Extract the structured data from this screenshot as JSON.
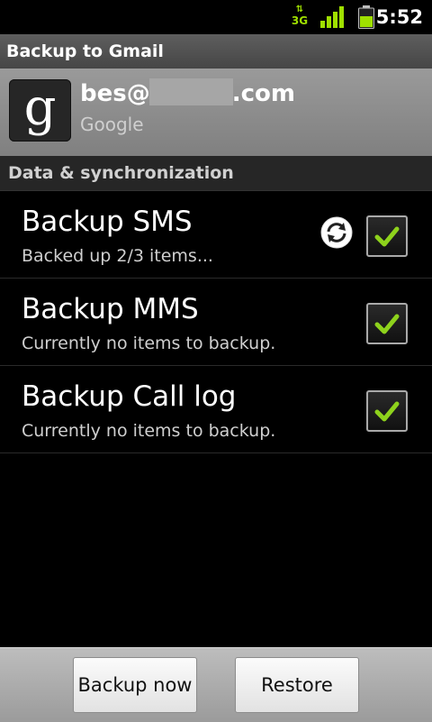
{
  "status": {
    "network_type": "3G",
    "time": "5:52"
  },
  "titlebar": {
    "title": "Backup to Gmail"
  },
  "account": {
    "email_prefix": "bes@",
    "email_suffix": ".com",
    "provider": "Google"
  },
  "section": {
    "title": "Data & synchronization"
  },
  "rows": [
    {
      "title": "Backup SMS",
      "summary": "Backed up 2/3 items...",
      "checked": true,
      "syncing": true
    },
    {
      "title": "Backup MMS",
      "summary": "Currently no items to backup.",
      "checked": true,
      "syncing": false
    },
    {
      "title": "Backup Call log",
      "summary": "Currently no items to backup.",
      "checked": true,
      "syncing": false
    }
  ],
  "buttons": {
    "backup_label": "Backup now",
    "restore_label": "Restore"
  },
  "colors": {
    "accent_green": "#9fe000",
    "check_green": "#8ed21c"
  }
}
